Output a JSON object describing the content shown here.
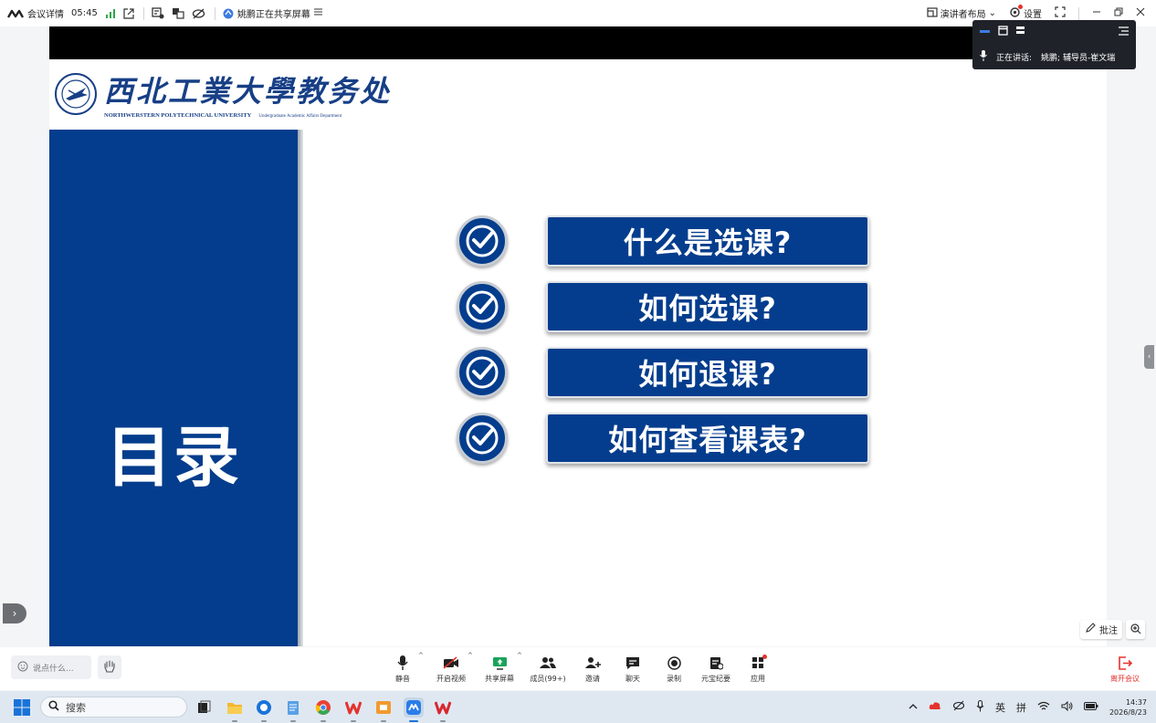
{
  "topbar": {
    "meeting_details": "会议详情",
    "elapsed": "05:45",
    "sharing_status": "姚鹏正在共享屏幕",
    "layout_label": "演讲者布局",
    "settings_label": "设置"
  },
  "speaker_panel": {
    "speaking_prefix": "正在讲话:",
    "speaking_names": "姚鹏; 辅导员-崔文瑞"
  },
  "slide": {
    "logo_cn": "西北工業大學教务处",
    "logo_en": "NORTHWERSTERN POLYTECHNICAL UNIVERSITY",
    "logo_en_sub": "Undergraduate Academic Affairs Department",
    "panel_title": "目录",
    "menu_items": [
      "什么是选课?",
      "如何选课?",
      "如何退课?",
      "如何查看课表?"
    ],
    "accent_color": "#043d8d"
  },
  "annotate_label": "批注",
  "bottombar": {
    "chat_placeholder": "说点什么...",
    "tools": {
      "mute": "静音",
      "video": "开启视频",
      "share": "共享屏幕",
      "members": "成员(99+)",
      "invite": "邀请",
      "chat": "聊天",
      "record": "录制",
      "notes": "元宝纪要",
      "apps": "应用"
    },
    "leave": "离开会议"
  },
  "taskbar": {
    "search_placeholder": "搜索",
    "ime_lang": "英",
    "ime_mode": "拼",
    "time": "14:37",
    "date": "2026/8/23"
  }
}
